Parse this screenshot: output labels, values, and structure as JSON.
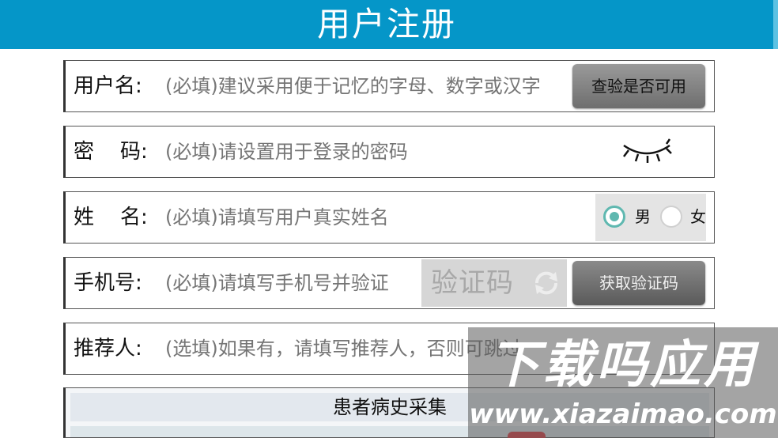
{
  "header": {
    "title": "用户注册"
  },
  "username": {
    "label": "用户名:",
    "placeholder": "(必填)建议采用便于记忆的字母、数字或汉字",
    "check_button": "查验是否可用"
  },
  "password": {
    "label": "密    码:",
    "placeholder": "(必填)请设置用于登录的密码",
    "visibility_icon": "eye-closed-icon"
  },
  "name": {
    "label": "姓    名:",
    "placeholder": "(必填)请填写用户真实姓名",
    "gender": {
      "selected": "男",
      "options": [
        "男",
        "女"
      ]
    }
  },
  "phone": {
    "label": "手机号:",
    "placeholder": "(必填)请填写手机号并验证",
    "captcha_text": "验证码",
    "refresh_icon": "refresh-icon",
    "get_code_button": "获取验证码"
  },
  "referrer": {
    "label": "推荐人:",
    "placeholder": "(选填)如果有，请填写推荐人，否则可跳过"
  },
  "history_panel": {
    "title": "患者病史采集"
  },
  "watermark": {
    "line1": "下载吗应用",
    "line2": "www.xiazaimao.com"
  },
  "colors": {
    "header_bg": "#0596c8",
    "radio_accent": "#5fb8b0",
    "button_gray": "#6e6e6e"
  }
}
